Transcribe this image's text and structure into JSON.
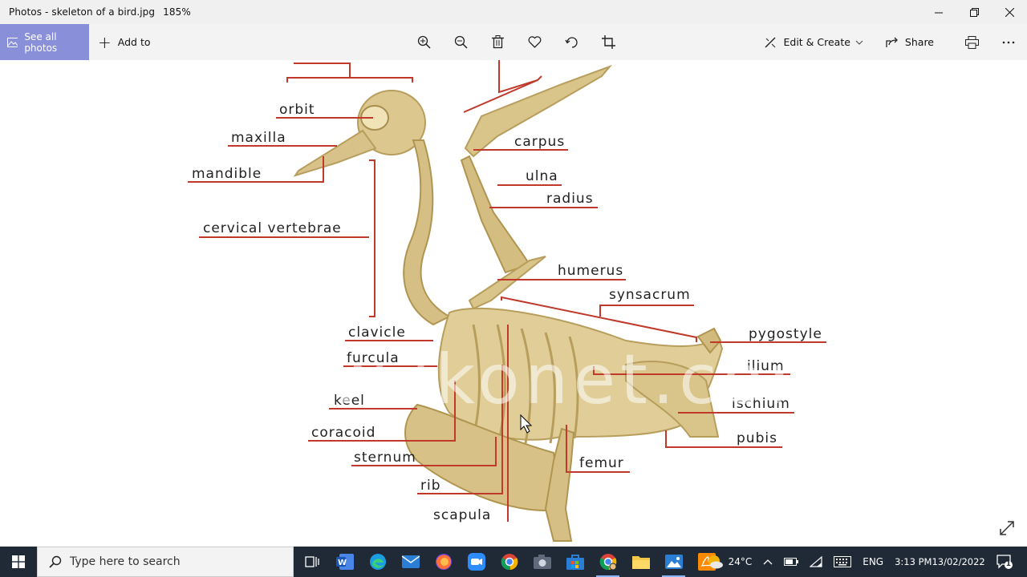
{
  "window": {
    "title": "Photos - skeleton of a bird.jpg",
    "zoom": "185%"
  },
  "toolbar": {
    "see_all_photos": "See all photos",
    "add_to": "Add to",
    "edit_create": "Edit & Create",
    "share": "Share",
    "tools": [
      "zoom-in-icon",
      "zoom-out-icon",
      "delete-icon",
      "heart-icon",
      "rotate-icon",
      "crop-icon"
    ]
  },
  "diagram": {
    "labels": {
      "orbit": "orbit",
      "maxilla": "maxilla",
      "mandible": "mandible",
      "cervical_vertebrae": "cervical vertebrae",
      "clavicle": "clavicle",
      "furcula": "furcula",
      "keel": "keel",
      "coracoid": "coracoid",
      "sternum": "sternum",
      "rib": "rib",
      "scapula": "scapula",
      "carpus": "carpus",
      "ulna": "ulna",
      "radius": "radius",
      "humerus": "humerus",
      "synsacrum": "synsacrum",
      "pygostyle": "pygostyle",
      "ilium": "ilium",
      "ischium": "ischium",
      "pubis": "pubis",
      "femur": "femur"
    },
    "watermark": "www.ikonet.com",
    "colors": {
      "bone": "#d9c48a",
      "bone_dark": "#b79e5c",
      "leader": "#c0392b"
    }
  },
  "taskbar": {
    "search_placeholder": "Type here to search",
    "weather": "24°C",
    "language": "ENG",
    "time": "3:13 PM",
    "date": "13/02/2022",
    "notifications": "1"
  }
}
